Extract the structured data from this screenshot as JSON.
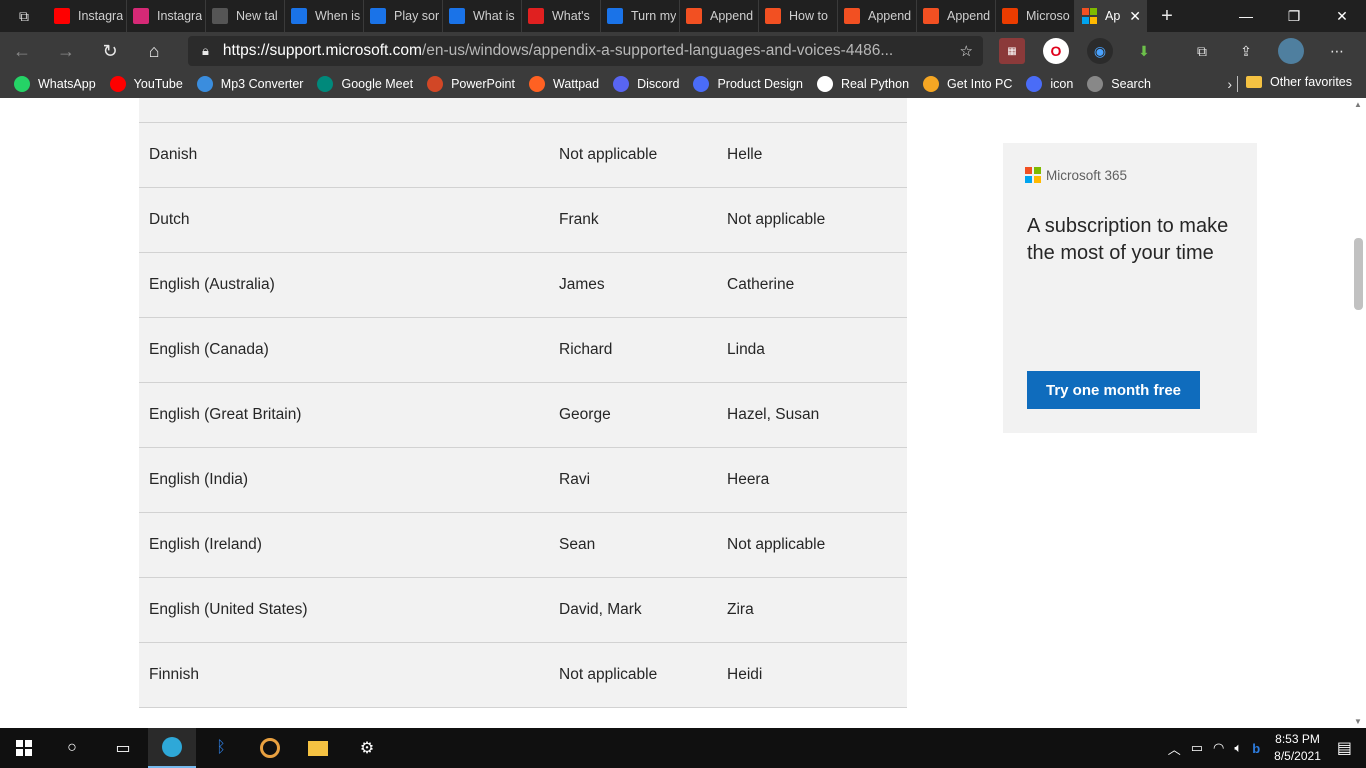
{
  "browser": {
    "tabs": [
      {
        "title": "Instagra",
        "icon": "youtube-icon",
        "color": "#ff0000"
      },
      {
        "title": "Instagra",
        "icon": "instagram-icon",
        "color": "#d62976"
      },
      {
        "title": "New tal",
        "icon": "new-tab-icon",
        "color": "#555555"
      },
      {
        "title": "When is",
        "icon": "bing-icon",
        "color": "#1a73e8"
      },
      {
        "title": "Play sor",
        "icon": "bing-icon",
        "color": "#1a73e8"
      },
      {
        "title": "What is",
        "icon": "bing-icon",
        "color": "#1a73e8"
      },
      {
        "title": "What's",
        "icon": "red-arrow-icon",
        "color": "#e02020"
      },
      {
        "title": "Turn my",
        "icon": "bing-icon",
        "color": "#1a73e8"
      },
      {
        "title": "Append",
        "icon": "microsoft-icon",
        "color": "#f25022"
      },
      {
        "title": "How to",
        "icon": "microsoft-icon",
        "color": "#f25022"
      },
      {
        "title": "Append",
        "icon": "microsoft-icon",
        "color": "#f25022"
      },
      {
        "title": "Append",
        "icon": "microsoft-icon",
        "color": "#f25022"
      },
      {
        "title": "Microso",
        "icon": "office-icon",
        "color": "#eb3c00"
      }
    ],
    "active_tab": {
      "title": "Ap",
      "icon": "microsoft-icon"
    },
    "address": {
      "host": "https://support.microsoft.com",
      "path": "/en-us/windows/appendix-a-supported-languages-and-voices-4486..."
    }
  },
  "favorites": [
    {
      "label": "WhatsApp",
      "icon": "whatsapp-icon",
      "color": "#25d366"
    },
    {
      "label": "YouTube",
      "icon": "youtube-icon",
      "color": "#ff0000"
    },
    {
      "label": "Mp3 Converter",
      "icon": "converter-icon",
      "color": "#3a8dde"
    },
    {
      "label": "Google Meet",
      "icon": "google-meet-icon",
      "color": "#00897b"
    },
    {
      "label": "PowerPoint",
      "icon": "powerpoint-icon",
      "color": "#d24726"
    },
    {
      "label": "Wattpad",
      "icon": "wattpad-icon",
      "color": "#ff6122"
    },
    {
      "label": "Discord",
      "icon": "discord-icon",
      "color": "#5865f2"
    },
    {
      "label": "Product Design",
      "icon": "product-design-icon",
      "color": "#4a6cf7"
    },
    {
      "label": "Real Python",
      "icon": "python-icon",
      "color": "#ffffff"
    },
    {
      "label": "Get Into PC",
      "icon": "getintopc-icon",
      "color": "#f5a623"
    },
    {
      "label": "icon",
      "icon": "star-icon",
      "color": "#4a6cf7"
    },
    {
      "label": "Search",
      "icon": "search-icon",
      "color": "#888888"
    }
  ],
  "other_favorites": "Other favorites",
  "table": {
    "rows": [
      {
        "language": "Danish",
        "male": "Not applicable",
        "female": "Helle"
      },
      {
        "language": "Dutch",
        "male": "Frank",
        "female": "Not applicable"
      },
      {
        "language": "English (Australia)",
        "male": "James",
        "female": "Catherine"
      },
      {
        "language": "English (Canada)",
        "male": "Richard",
        "female": "Linda"
      },
      {
        "language": "English (Great Britain)",
        "male": "George",
        "female": "Hazel, Susan"
      },
      {
        "language": "English (India)",
        "male": "Ravi",
        "female": "Heera"
      },
      {
        "language": "English (Ireland)",
        "male": "Sean",
        "female": "Not applicable"
      },
      {
        "language": "English (United States)",
        "male": "David, Mark",
        "female": "Zira"
      },
      {
        "language": "Finnish",
        "male": "Not applicable",
        "female": "Heidi"
      }
    ]
  },
  "promo": {
    "brand": "Microsoft 365",
    "text": "A subscription to make the most of your time",
    "button": "Try one month free"
  },
  "taskbar": {
    "time": "8:53 PM",
    "date": "8/5/2021"
  },
  "colors": {
    "accent": "#0f6cbd",
    "row_bg": "#f2f2f2"
  }
}
